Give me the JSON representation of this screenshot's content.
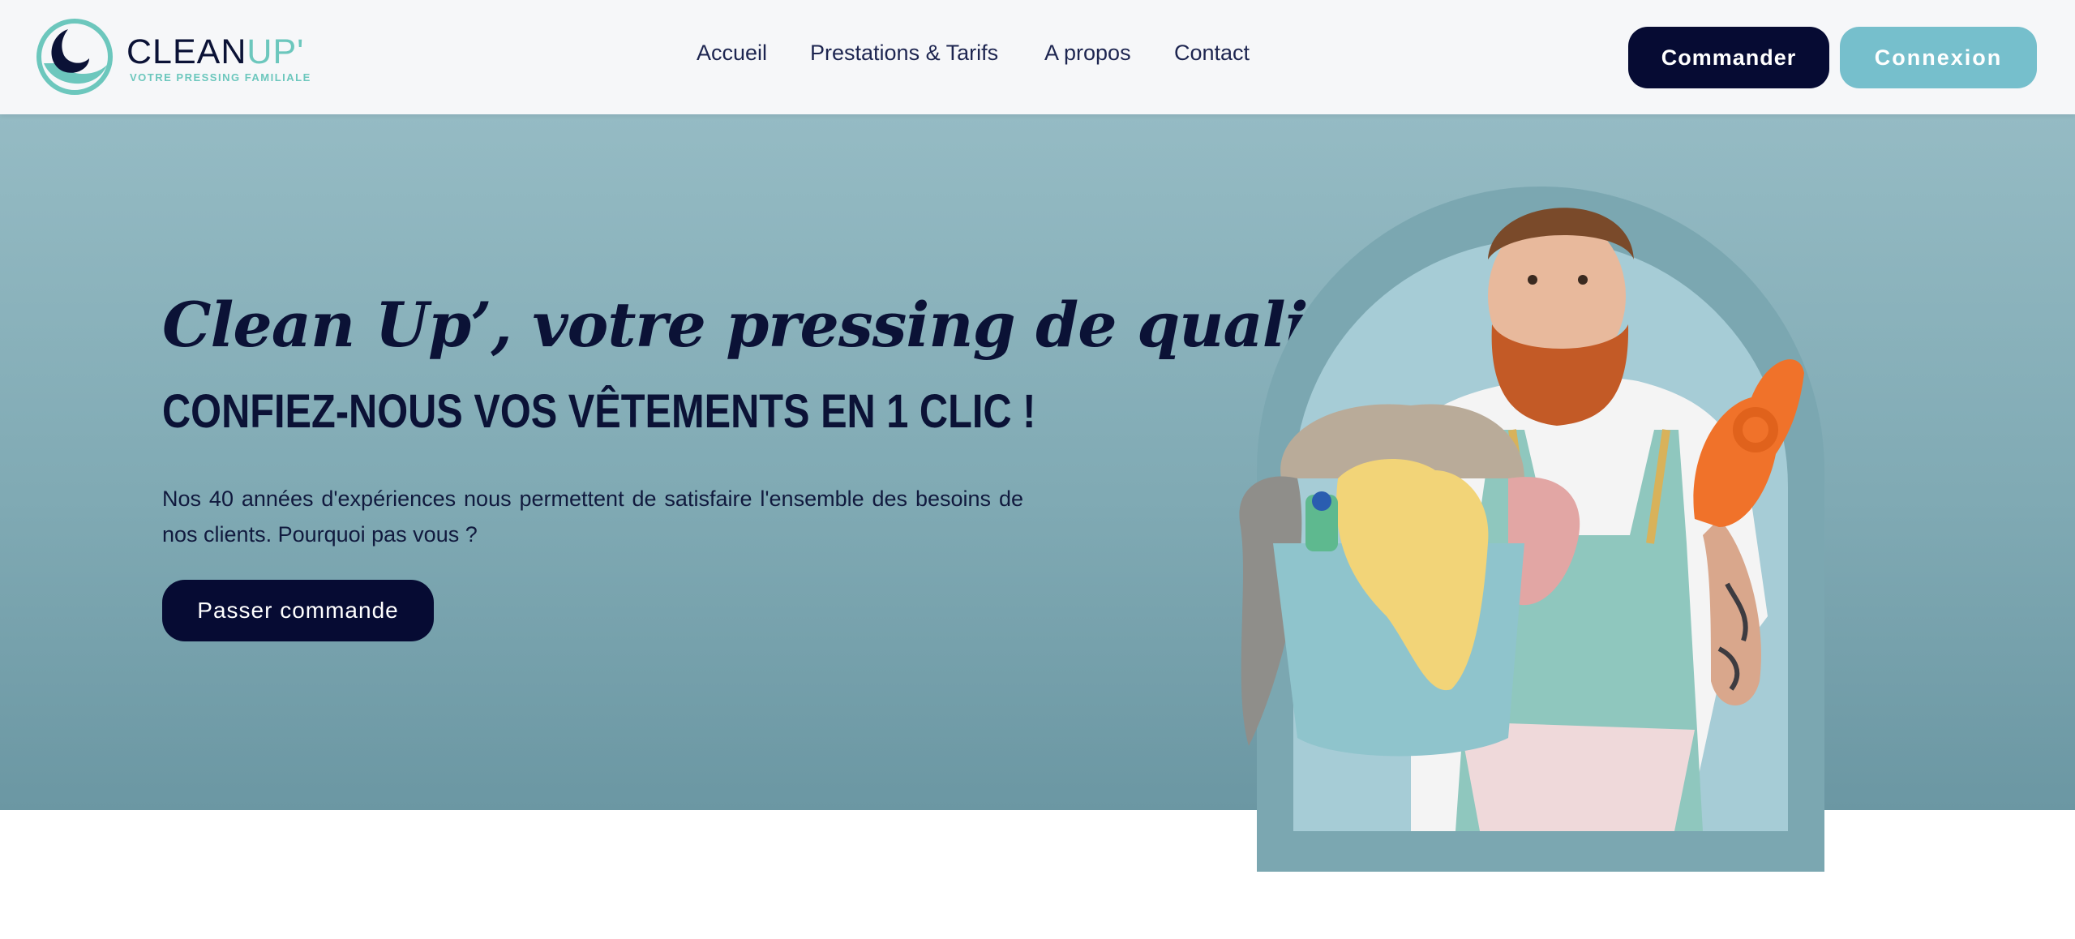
{
  "brand": {
    "name_main": "CLEAN",
    "name_accent": "UP'",
    "tagline": "VOTRE PRESSING FAMILIALE"
  },
  "nav": {
    "items": [
      {
        "label": "Accueil"
      },
      {
        "label": "Prestations & Tarifs"
      },
      {
        "label": "A propos"
      },
      {
        "label": "Contact"
      }
    ]
  },
  "header_actions": {
    "order_label": "Commander",
    "login_label": "Connexion"
  },
  "hero": {
    "script_title": "Clean Up’, votre pressing de qualité",
    "headline": "CONFIEZ-NOUS VOS VÊTEMENTS EN 1 CLIC !",
    "description": "Nos 40 années d'expériences nous permettent de satisfaire l'ensemble des besoins de nos clients. Pourquoi pas vous ?",
    "cta_label": "Passer commande"
  },
  "colors": {
    "navy": "#060b33",
    "teal_button": "#76bfcc",
    "hero_bg": "#88b1bb",
    "logo_accent": "#6cc7bd"
  },
  "icons": {
    "logo": "wave-moon-logo-icon"
  }
}
